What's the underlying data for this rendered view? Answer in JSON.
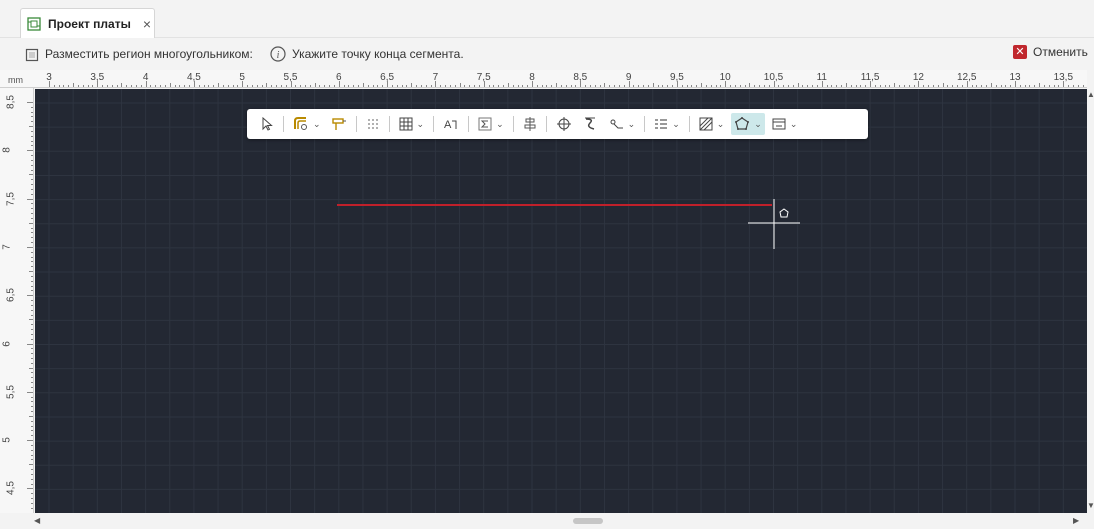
{
  "tab": {
    "title": "Проект платы",
    "close": "×"
  },
  "command": {
    "label": "Разместить регион многоугольником:",
    "prompt": "Укажите точку конца сегмента.",
    "cancel": "Отменить"
  },
  "ruler": {
    "unit": "mm",
    "h_labels": [
      "3",
      "3,5",
      "4",
      "4,5",
      "5",
      "5,5",
      "6",
      "6,5",
      "7",
      "7,5",
      "8",
      "8,5",
      "9",
      "9,5",
      "10",
      "10,5",
      "11",
      "11,5",
      "12",
      "12,5",
      "13",
      "13,5"
    ],
    "v_labels": [
      "8,5",
      "8",
      "7,5",
      "7",
      "6,5",
      "6",
      "5,5",
      "5",
      "4,5"
    ]
  },
  "toolbar": {
    "items": [
      "select-icon",
      "route-icon",
      "pin-icon",
      "grid-dots-icon",
      "table-icon",
      "text-icon",
      "sum-icon",
      "align-icon",
      "crosshair-icon",
      "spiral-icon",
      "measure-icon",
      "layers-icon",
      "hatch-icon",
      "polygon-icon",
      "component-icon"
    ]
  },
  "drawing": {
    "segment_color": "#c0202a",
    "crosshair_color": "#ffffff",
    "canvas_bg": "#232833"
  }
}
